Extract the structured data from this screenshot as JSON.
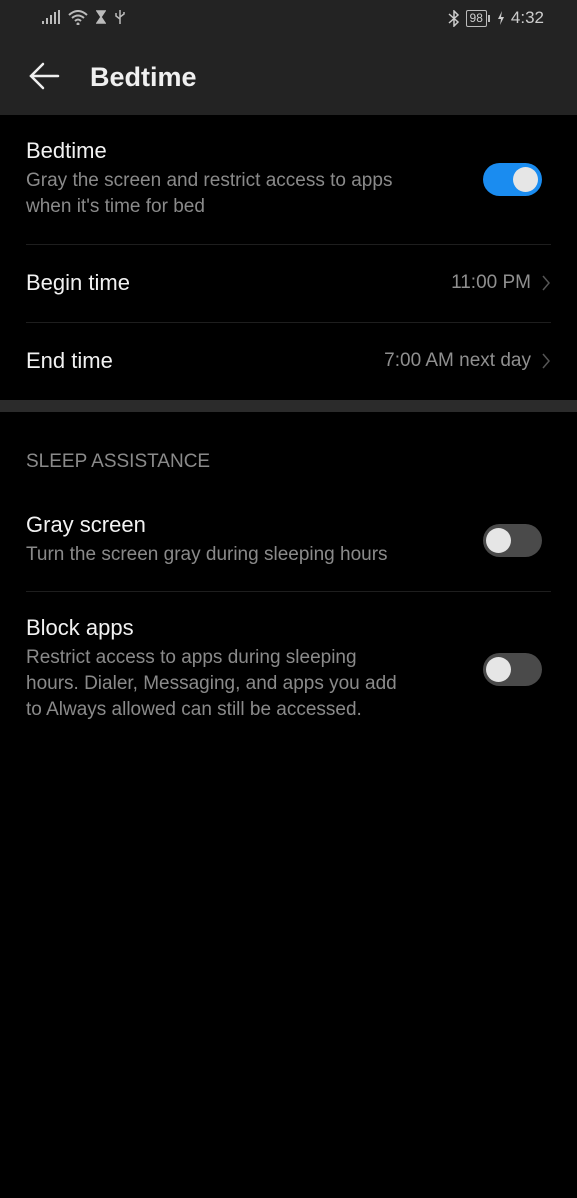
{
  "status_bar": {
    "battery": "98",
    "time": "4:32",
    "icons": [
      "signal-icon",
      "wifi-icon",
      "hourglass-icon",
      "usb-icon",
      "bluetooth-icon",
      "battery-icon",
      "charging-icon"
    ]
  },
  "app_bar": {
    "title": "Bedtime",
    "back_icon": "arrow-left-icon"
  },
  "bedtime": {
    "title": "Bedtime",
    "subtitle_line1": "Gray the screen and restrict access to apps",
    "subtitle_line2": "when it's time for bed",
    "enabled": true
  },
  "begin_time": {
    "label": "Begin time",
    "value": "11:00 PM"
  },
  "end_time": {
    "label": "End time",
    "value": "7:00 AM next day"
  },
  "section_header": "SLEEP ASSISTANCE",
  "gray_screen": {
    "title": "Gray screen",
    "subtitle": "Turn the screen gray during sleeping hours",
    "enabled": false
  },
  "block_apps": {
    "title": "Block apps",
    "subtitle_line1": "Restrict access to apps during sleeping",
    "subtitle_line2": "hours. Dialer, Messaging, and apps you add",
    "subtitle_line3": "to Always allowed can still be accessed.",
    "enabled": false
  },
  "colors": {
    "accent": "#1a8cf0",
    "background": "#000000",
    "bar": "#232323"
  }
}
